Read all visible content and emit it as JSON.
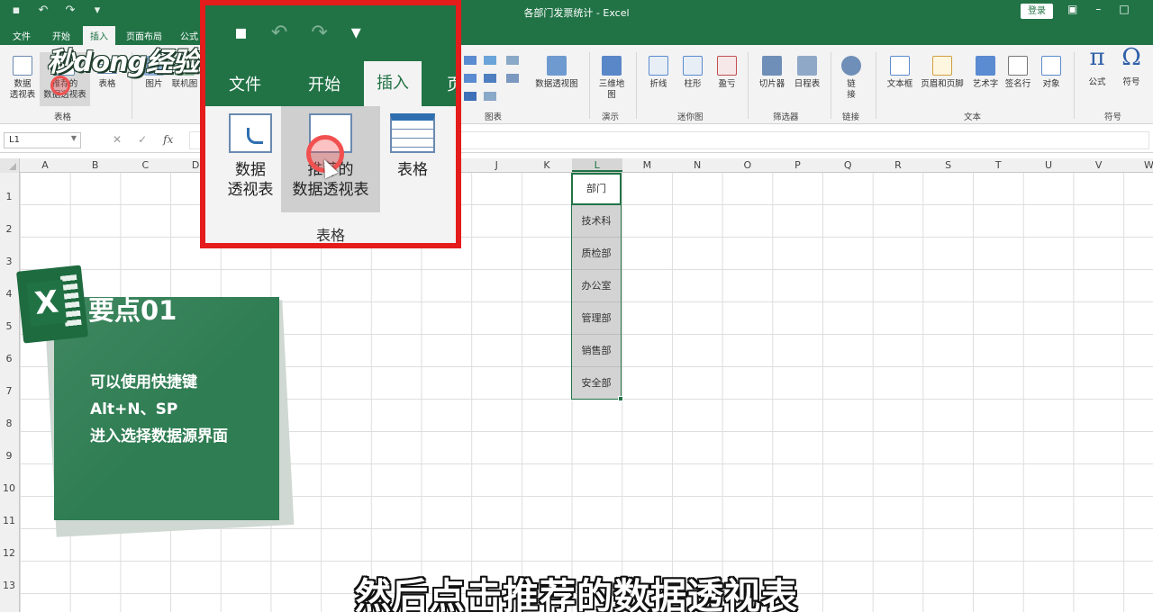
{
  "titlebar": {
    "doc_title": "各部门发票统计 - Excel",
    "login_label": "登录"
  },
  "tabs": [
    "文件",
    "开始",
    "插入",
    "页面布局",
    "公式"
  ],
  "active_tab": "插入",
  "ribbon": {
    "pivot_btn": "数据\n透视表",
    "rec_pivot_btn": "推荐的\n数据透视表",
    "table_btn": "表格",
    "group_tables": "表格",
    "picture_btn": "图片",
    "online_pic_btn": "联机图",
    "group_charts": "图表",
    "pivotchart_btn": "数据透视图",
    "map3d_btn": "三维地\n图",
    "group_tours": "演示",
    "line_btn": "折线",
    "column_btn": "柱形",
    "winloss_btn": "盈亏",
    "group_sparklines": "迷你图",
    "slicer_btn": "切片器",
    "timeline_btn": "日程表",
    "group_filters": "筛选器",
    "link_btn": "链\n接",
    "group_links": "链接",
    "textbox_btn": "文本框",
    "header_footer_btn": "页眉和页脚",
    "wordart_btn": "艺术字",
    "signature_btn": "签名行",
    "object_btn": "对象",
    "group_text": "文本",
    "equation_btn": "公式",
    "symbol_btn": "符号",
    "group_symbols": "符号"
  },
  "formula_bar": {
    "name_box": "L1",
    "fx": "fx"
  },
  "columns": [
    "A",
    "B",
    "C",
    "D",
    "E",
    "F",
    "G",
    "H",
    "I",
    "J",
    "K",
    "L",
    "M",
    "N",
    "O",
    "P",
    "Q",
    "R",
    "S",
    "T",
    "U",
    "V",
    "W"
  ],
  "selected_column": "L",
  "rows": [
    "1",
    "2",
    "3",
    "4",
    "5",
    "6",
    "7",
    "8",
    "9",
    "10",
    "11",
    "12",
    "13"
  ],
  "cells_L": [
    "部门",
    "技术科",
    "质检部",
    "办公室",
    "管理部",
    "销售部",
    "安全部"
  ],
  "zoom": {
    "tabs": [
      "文件",
      "开始",
      "插入",
      "页"
    ],
    "pivot": "数据\n透视表",
    "rec_pivot": "推荐的\n数据透视表",
    "table": "表格",
    "group": "表格"
  },
  "tip": {
    "logo_letter": "X",
    "title": "要点01",
    "lines": [
      "可以使用快捷键",
      "Alt+N、SP",
      "进入选择数据源界面"
    ]
  },
  "watermark": "秒dong经验",
  "subtitle": "然后点击推荐的数据透视表",
  "colors": {
    "excel_green": "#217346",
    "highlight_red": "#e51c1c",
    "tip_green": "#2f7d53"
  }
}
